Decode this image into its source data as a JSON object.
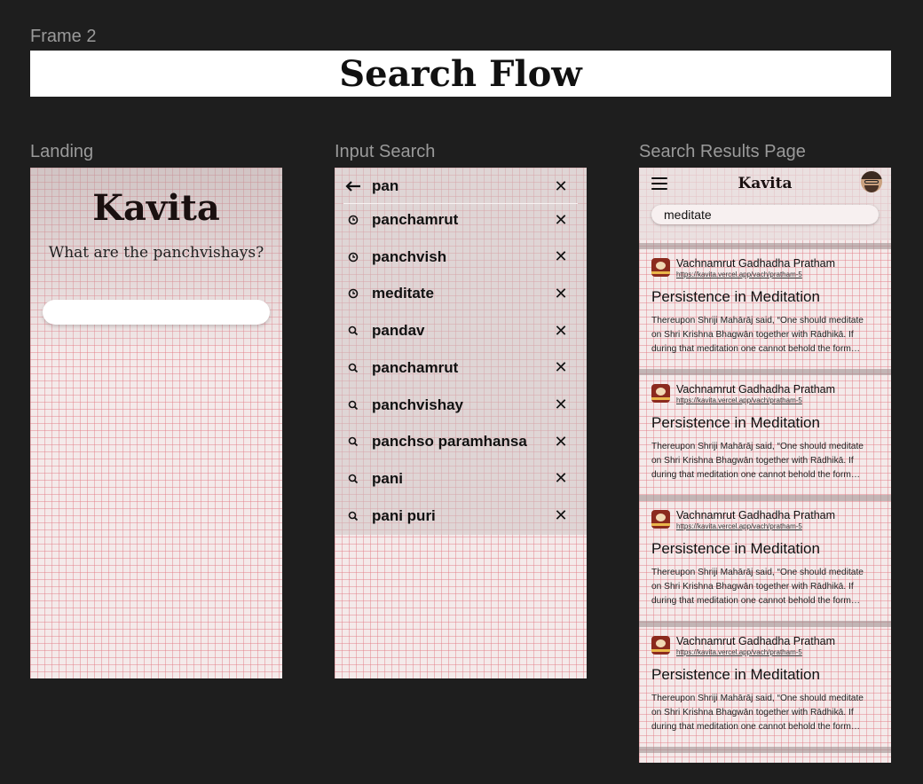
{
  "frame": {
    "label": "Frame 2",
    "title": "Search Flow"
  },
  "landing": {
    "label": "Landing",
    "brand": "Kavita",
    "question": "What are the panchvishays?"
  },
  "input_search": {
    "label": "Input Search",
    "query": "pan",
    "suggestions": [
      {
        "kind": "history",
        "icon": "clock-icon",
        "text": "panchamrut"
      },
      {
        "kind": "history",
        "icon": "clock-icon",
        "text": "panchvish"
      },
      {
        "kind": "history",
        "icon": "clock-icon",
        "text": "meditate"
      },
      {
        "kind": "suggest",
        "icon": "search-icon",
        "text": "pandav"
      },
      {
        "kind": "suggest",
        "icon": "search-icon",
        "text": "panchamrut"
      },
      {
        "kind": "suggest",
        "icon": "search-icon",
        "text": "panchvishay"
      },
      {
        "kind": "suggest",
        "icon": "search-icon",
        "text": "panchso paramhansa"
      },
      {
        "kind": "suggest",
        "icon": "search-icon",
        "text": "pani"
      },
      {
        "kind": "suggest",
        "icon": "search-icon",
        "text": "pani puri"
      }
    ]
  },
  "results": {
    "label": "Search Results Page",
    "brand": "Kavita",
    "query": "meditate",
    "cards": [
      {
        "source": "Vachnamrut Gadhadha Pratham",
        "url": "https://kavita.vercel.app/vach/pratham-5",
        "headline": "Persistence in Meditation",
        "snippet_lines": [
          "Thereupon Shriji Mahārāj said, “One should meditate",
          "on Shri Krishna Bhagwān together with Rādhikā. If",
          "during that meditation one cannot behold the form…"
        ]
      },
      {
        "source": "Vachnamrut Gadhadha Pratham",
        "url": "https://kavita.vercel.app/vach/pratham-5",
        "headline": "Persistence in Meditation",
        "snippet_lines": [
          "Thereupon Shriji Mahārāj said, “One should meditate",
          "on Shri Krishna Bhagwān together with Rādhikā. If",
          "during that meditation one cannot behold the form…"
        ]
      },
      {
        "source": "Vachnamrut Gadhadha Pratham",
        "url": "https://kavita.vercel.app/vach/pratham-5",
        "headline": "Persistence in Meditation",
        "snippet_lines": [
          "Thereupon Shriji Mahārāj said, “One should meditate",
          "on Shri Krishna Bhagwān together with Rādhikā. If",
          "during that meditation one cannot behold the form…"
        ]
      },
      {
        "source": "Vachnamrut Gadhadha Pratham",
        "url": "https://kavita.vercel.app/vach/pratham-5",
        "headline": "Persistence in Meditation",
        "snippet_lines": [
          "Thereupon Shriji Mahārāj said, “One should meditate",
          "on Shri Krishna Bhagwān together with Rādhikā. If",
          "during that meditation one cannot behold the form…"
        ]
      }
    ]
  }
}
